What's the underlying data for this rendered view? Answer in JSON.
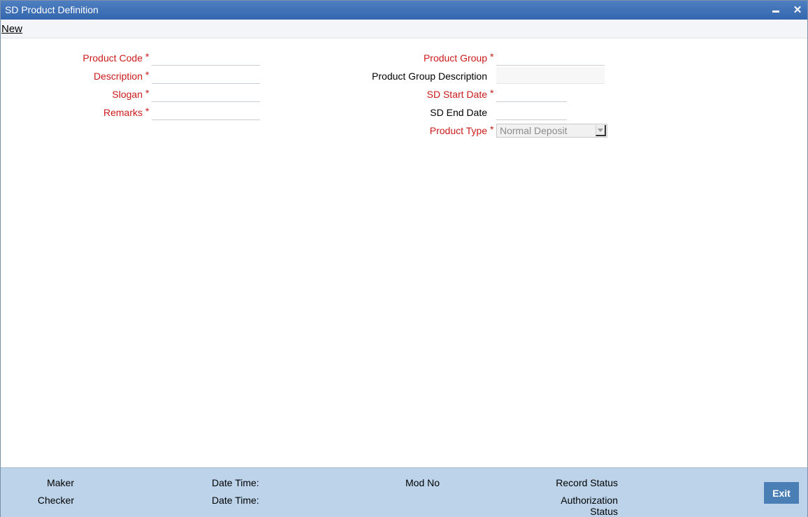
{
  "window": {
    "title": "SD Product Definition",
    "close_glyph": "✕"
  },
  "menu": {
    "new_label": "New"
  },
  "form": {
    "product_code_label": "Product Code",
    "description_label": "Description",
    "slogan_label": "Slogan",
    "remarks_label": "Remarks",
    "product_group_label": "Product Group",
    "product_group_description_label": "Product Group Description",
    "sd_start_date_label": "SD Start Date",
    "sd_end_date_label": "SD End Date",
    "product_type_label": "Product Type",
    "product_type_value": "Normal Deposit",
    "required_marker": "*",
    "values": {
      "product_code": "",
      "description": "",
      "slogan": "",
      "remarks": "",
      "product_group": "",
      "product_group_description": "",
      "sd_start_date": "",
      "sd_end_date": ""
    }
  },
  "footer": {
    "maker_label": "Maker",
    "checker_label": "Checker",
    "date_time_label_1": "Date Time:",
    "date_time_label_2": "Date Time:",
    "mod_no_label": "Mod No",
    "record_status_label": "Record Status",
    "authorization_label": "Authorization",
    "status_label": "Status",
    "exit_label": "Exit"
  },
  "colors": {
    "title_bar": "#3d6fb5",
    "required_label": "#cc1a1a",
    "footer_bg": "#bcd3ea",
    "exit_button": "#4a7fb6"
  }
}
